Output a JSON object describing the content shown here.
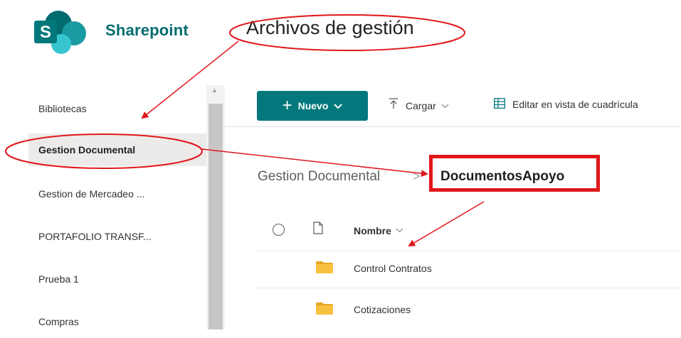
{
  "header": {
    "logo_letter": "S",
    "brand": "Sharepoint",
    "site_title": "Archivos de gestión"
  },
  "sidebar": {
    "items": [
      {
        "label": "Bibliotecas"
      },
      {
        "label": "Gestion Documental"
      },
      {
        "label": "Gestion de Mercadeo ..."
      },
      {
        "label": "PORTAFOLIO TRANSF..."
      },
      {
        "label": "Prueba 1"
      },
      {
        "label": "Compras"
      }
    ],
    "selected_index": 1
  },
  "commandbar": {
    "new_label": "Nuevo",
    "upload_label": "Cargar",
    "grid_label": "Editar en vista de cuadrícula"
  },
  "breadcrumb": {
    "parent": "Gestion Documental",
    "separator": ">",
    "current": "DocumentosApoyo"
  },
  "list": {
    "column_name": "Nombre",
    "rows": [
      {
        "name": "Control Contratos",
        "type": "folder"
      },
      {
        "name": "Cotizaciones",
        "type": "folder"
      }
    ]
  },
  "colors": {
    "brand_teal": "#036c70",
    "new_button": "#03787c",
    "annotation_red": "#e0161b",
    "folder_yellow": "#f8c03f"
  },
  "icons": [
    "sharepoint-logo-icon",
    "plus-icon",
    "chevron-down-icon",
    "upload-icon",
    "grid-icon",
    "radio-circle-icon",
    "document-icon",
    "folder-icon"
  ]
}
